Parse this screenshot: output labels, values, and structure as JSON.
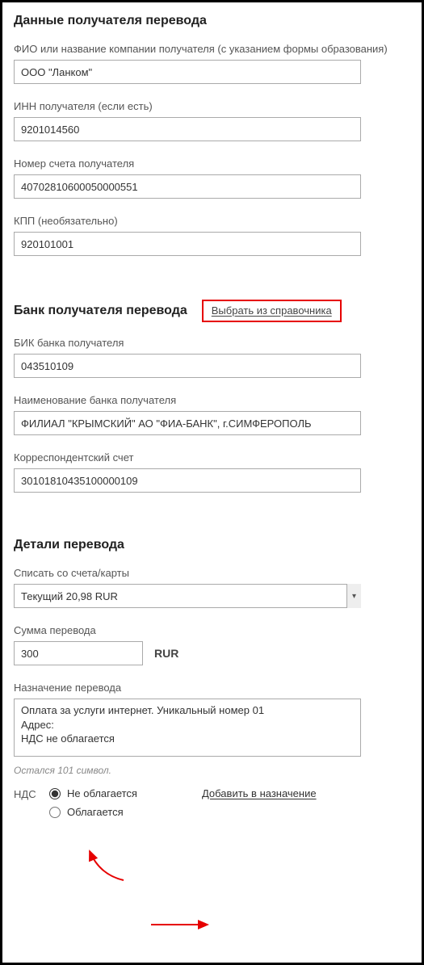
{
  "recipient": {
    "heading": "Данные получателя перевода",
    "name_label": "ФИО или название компании получателя (с указанием формы образования)",
    "name_value": "ООО \"Ланком\"",
    "inn_label": "ИНН получателя (если есть)",
    "inn_value": "9201014560",
    "account_label": "Номер счета получателя",
    "account_value": "40702810600050000551",
    "kpp_label": "КПП (необязательно)",
    "kpp_value": "920101001"
  },
  "bank": {
    "heading": "Банк получателя перевода",
    "pick_from_directory": "Выбрать из справочника",
    "bik_label": "БИК банка получателя",
    "bik_value": "043510109",
    "bank_name_label": "Наименование банка получателя",
    "bank_name_value": "ФИЛИАЛ \"КРЫМСКИЙ\" АО \"ФИА-БАНК\", г.СИМФЕРОПОЛЬ",
    "corr_label": "Корреспондентский счет",
    "corr_value": "30101810435100000109"
  },
  "details": {
    "heading": "Детали перевода",
    "from_account_label": "Списать со счета/карты",
    "from_account_value": "Текущий 20,98 RUR",
    "amount_label": "Сумма перевода",
    "amount_value": "300",
    "currency": "RUR",
    "purpose_label": "Назначение перевода",
    "purpose_value": "Оплата за услуги интернет. Уникальный номер 01\nАдрес:\nНДС не облагается",
    "chars_left": "Остался 101 символ.",
    "vat_label": "НДС",
    "vat_opt_no": "Не облагается",
    "vat_opt_yes": "Облагается",
    "add_to_purpose": "Добавить в назначение"
  }
}
